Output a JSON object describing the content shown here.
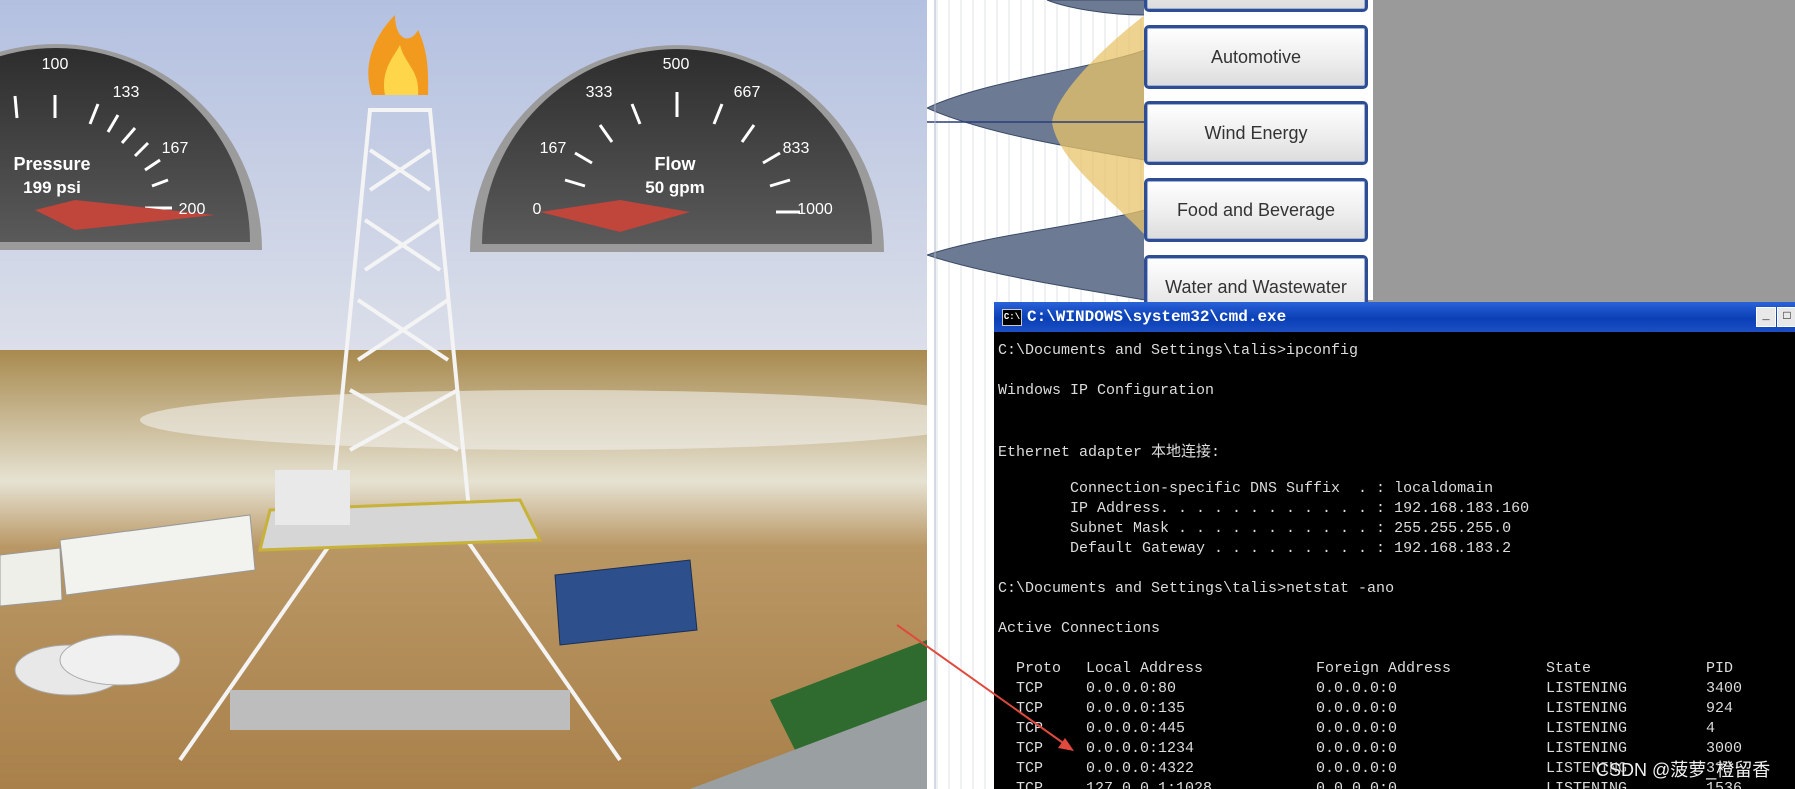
{
  "gauges": {
    "pressure": {
      "ticks": [
        "100",
        "133",
        "167",
        "200"
      ],
      "label": "Pressure",
      "value_text": "199 psi"
    },
    "flow": {
      "ticks": [
        "0",
        "167",
        "333",
        "500",
        "667",
        "833",
        "1000"
      ],
      "label": "Flow",
      "value_text": "50 gpm"
    }
  },
  "industry_buttons": [
    "Automotive",
    "Wind Energy",
    "Food and Beverage",
    "Water and Wastewater"
  ],
  "cmd": {
    "title": "C:\\WINDOWS\\system32\\cmd.exe",
    "icon": "C:\\",
    "minimize": "_",
    "maximize": "□",
    "lines": [
      "C:\\Documents and Settings\\talis>ipconfig",
      "Windows IP Configuration",
      "Ethernet adapter 本地连接:",
      "        Connection-specific DNS Suffix  . : localdomain",
      "        IP Address. . . . . . . . . . . . : 192.168.183.160",
      "        Subnet Mask . . . . . . . . . . . : 255.255.255.0",
      "        Default Gateway . . . . . . . . . : 192.168.183.2",
      "C:\\Documents and Settings\\talis>netstat -ano",
      "Active Connections"
    ],
    "table": {
      "headers": [
        "Proto",
        "Local Address",
        "Foreign Address",
        "State",
        "PID"
      ],
      "rows": [
        [
          "TCP",
          "0.0.0.0:80",
          "0.0.0.0:0",
          "LISTENING",
          "3400"
        ],
        [
          "TCP",
          "0.0.0.0:135",
          "0.0.0.0:0",
          "LISTENING",
          "924"
        ],
        [
          "TCP",
          "0.0.0.0:445",
          "0.0.0.0:0",
          "LISTENING",
          "4"
        ],
        [
          "TCP",
          "0.0.0.0:1234",
          "0.0.0.0:0",
          "LISTENING",
          "3000"
        ],
        [
          "TCP",
          "0.0.0.0:4322",
          "0.0.0.0:0",
          "LISTENING",
          "3??"
        ],
        [
          "TCP",
          "127.0.0.1:1028",
          "0.0.0.0:0",
          "LISTENING",
          "1536"
        ]
      ]
    }
  },
  "watermark": "CSDN @菠萝_橙留香",
  "colors": {
    "sky": "#c9d3ea",
    "desert": "#b9915a",
    "cmd_title": "#0a3fb6",
    "button_border": "#2e4d92",
    "arrow": "#e0493d"
  }
}
